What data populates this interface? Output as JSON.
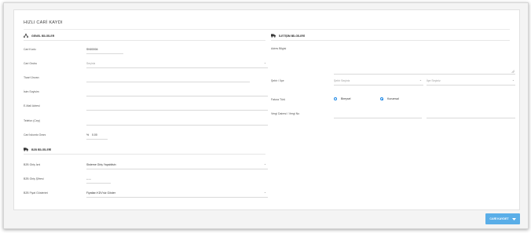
{
  "page": {
    "title": "HIZLI CARİ KAYDI"
  },
  "general": {
    "section_title": "GENEL BİLGİLER",
    "icon": "sitemap-icon",
    "cari_kodu": {
      "label": "Cari Kodu",
      "value": "SN00004"
    },
    "cari_grubu": {
      "label": "Cari Grubu",
      "value": "Seçiniz"
    },
    "ticari_unvan": {
      "label": "Ticari Ünvan",
      "value": ""
    },
    "isim_soyisim": {
      "label": "İsim Soyisim",
      "value": ""
    },
    "email": {
      "label": "E-Mail Adresi",
      "value": ""
    },
    "telefon": {
      "label": "Telefon (Cep)",
      "value": ""
    },
    "iskonto": {
      "label": "Cari İskonto Oranı",
      "prefix": "%",
      "value": "0.00"
    }
  },
  "b2b": {
    "section_title": "B2B BİLGİLERİ",
    "icon": "truck-icon",
    "giris_izni": {
      "label": "B2B Giriş İzni",
      "value": "Sisteme Giriş Yapabilsin"
    },
    "giris_sifresi": {
      "label": "B2B Giriş Şifresi",
      "value": "-----"
    },
    "fiyat_gosterimi": {
      "label": "B2B Fiyat Gösterimi",
      "value": "Fiyatları KDV'siz Göster"
    }
  },
  "contact": {
    "section_title": "İLETİŞİM BİLGİLERİ",
    "icon": "truck-icon",
    "adres": {
      "label": "Adres Bilgisi",
      "value": ""
    },
    "sehir_ilce": {
      "label": "Şehir / İlçe",
      "sehir": "Şehir Seçiniz",
      "ilce": "İlçe Seçiniz"
    },
    "fatura_turu": {
      "label": "Fatura Türü",
      "options": [
        "Bireysel",
        "Kurumsal"
      ],
      "selected": "Kurumsal"
    },
    "vergi": {
      "label": "Vergi Dairesi / Vergi No",
      "daire": "",
      "no": ""
    }
  },
  "actions": {
    "save_label": "CARİ KAYDET"
  },
  "colors": {
    "accent": "#1e88e5",
    "button": "#5aaee8"
  }
}
